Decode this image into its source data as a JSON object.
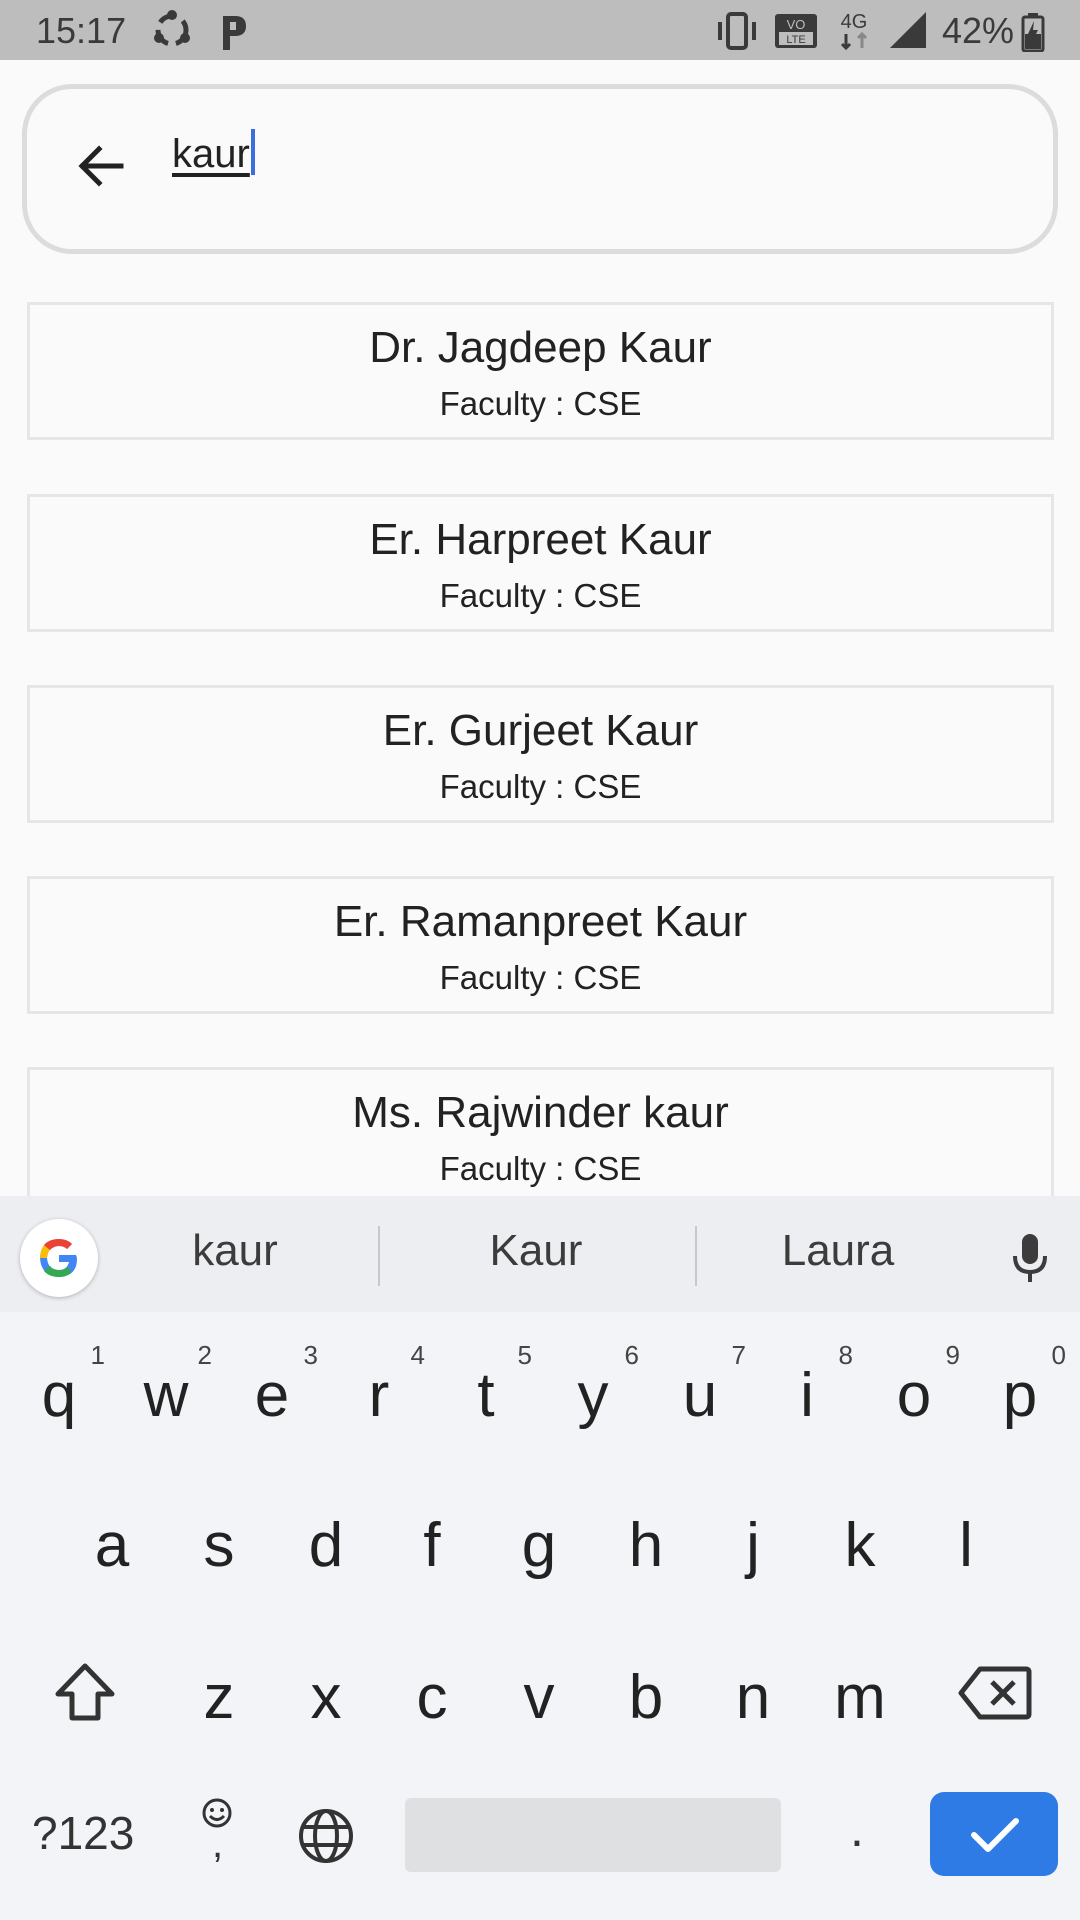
{
  "status_bar": {
    "time": "15:17",
    "battery": "42%",
    "icons": [
      "sync-icon",
      "p-icon",
      "vibrate-icon",
      "volte-icon",
      "4g-icon",
      "signal-icon",
      "battery-icon"
    ],
    "network_type": "4G",
    "volte_label": "VO\nLTE"
  },
  "search": {
    "query": "kaur",
    "back_icon": "arrow-back-icon"
  },
  "results": [
    {
      "name": "Dr. Jagdeep Kaur",
      "subtitle": "Faculty : CSE"
    },
    {
      "name": "Er. Harpreet Kaur",
      "subtitle": "Faculty : CSE"
    },
    {
      "name": "Er. Gurjeet Kaur",
      "subtitle": "Faculty : CSE"
    },
    {
      "name": "Er. Ramanpreet Kaur",
      "subtitle": "Faculty : CSE"
    },
    {
      "name": "Ms. Rajwinder kaur",
      "subtitle": "Faculty : CSE"
    }
  ],
  "keyboard": {
    "suggestions": [
      "kaur",
      "Kaur",
      "Laura"
    ],
    "row1": [
      {
        "k": "q",
        "h": "1"
      },
      {
        "k": "w",
        "h": "2"
      },
      {
        "k": "e",
        "h": "3"
      },
      {
        "k": "r",
        "h": "4"
      },
      {
        "k": "t",
        "h": "5"
      },
      {
        "k": "y",
        "h": "6"
      },
      {
        "k": "u",
        "h": "7"
      },
      {
        "k": "i",
        "h": "8"
      },
      {
        "k": "o",
        "h": "9"
      },
      {
        "k": "p",
        "h": "0"
      }
    ],
    "row2": [
      "a",
      "s",
      "d",
      "f",
      "g",
      "h",
      "j",
      "k",
      "l"
    ],
    "row3": [
      "z",
      "x",
      "c",
      "v",
      "b",
      "n",
      "m"
    ],
    "symbols_label": "?123",
    "period_label": ".",
    "comma_label": ",",
    "accent_color": "#2e7be5"
  }
}
